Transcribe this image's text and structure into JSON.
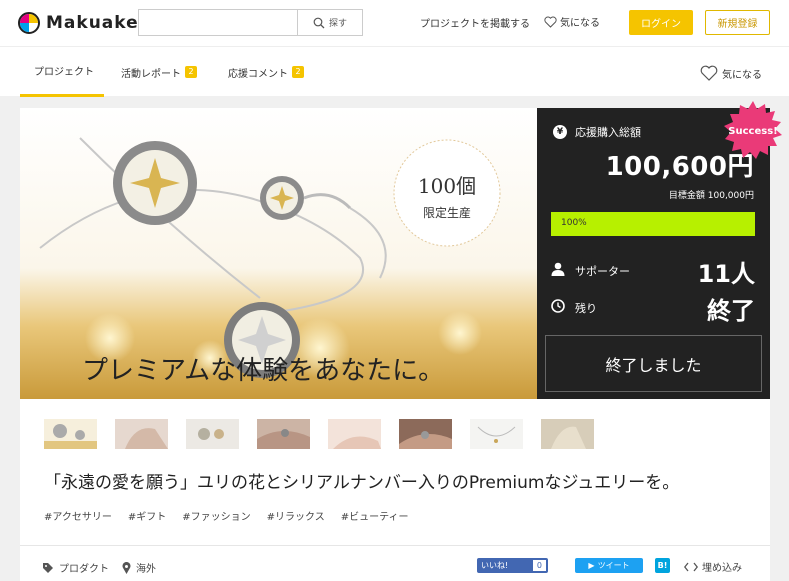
{
  "header": {
    "logo_text": "Makuake",
    "search": {
      "placeholder": "",
      "button_label": "探す"
    },
    "post_project_label": "プロジェクトを掲載する",
    "favorites_label": "気になる",
    "login_label": "ログイン",
    "signup_label": "新規登録"
  },
  "tabs": [
    {
      "label": "プロジェクト",
      "badge": ""
    },
    {
      "label": "活動レポート",
      "badge": "2"
    },
    {
      "label": "応援コメント",
      "badge": "2"
    }
  ],
  "tabs_favorite_label": "気になる",
  "hero": {
    "badge_number": "100個",
    "badge_text": "限定生産",
    "caption": "プレミアムな体験をあなたに。"
  },
  "stats": {
    "amount_label": "応援購入総額",
    "amount_value": "100,600円",
    "goal_text": "目標金額 100,000円",
    "progress_percent": 100,
    "progress_label": "100%",
    "supporters_label": "サポーター",
    "supporters_value": "11人",
    "remaining_label": "残り",
    "remaining_value": "終了",
    "ended_button_label": "終了しました",
    "success_badge": "Success!",
    "accent_color": "#b7f000"
  },
  "thumbnails": [
    "thumb-1",
    "thumb-2",
    "thumb-3",
    "thumb-4",
    "thumb-5",
    "thumb-6",
    "thumb-7",
    "thumb-8"
  ],
  "project": {
    "title": "「永遠の愛を願う」ユリの花とシリアルナンバー入りのPremiumなジュエリーを。",
    "tags": [
      "#アクセサリー",
      "#ギフト",
      "#ファッション",
      "#リラックス",
      "#ビューティー"
    ]
  },
  "footer": {
    "category_label": "プロダクト",
    "location_label": "海外",
    "fb_label": "いいね!",
    "fb_count": "0",
    "tweet_label": "ツイート",
    "hatena_label": "B!",
    "embed_label": "埋め込み"
  }
}
